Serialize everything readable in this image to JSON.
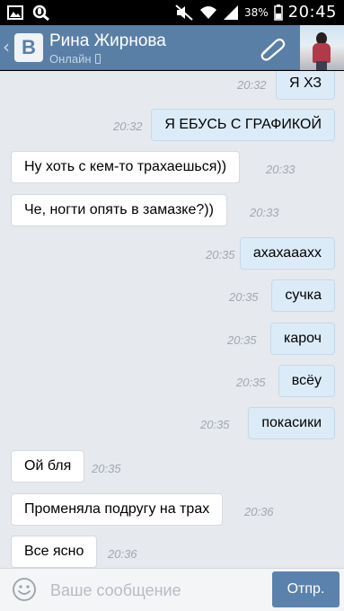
{
  "status_bar": {
    "battery_percent": "38%",
    "time": "20:45",
    "icons": [
      "image-icon",
      "voice-search-icon",
      "mute-icon",
      "wifi-icon",
      "signal-icon",
      "battery-icon"
    ]
  },
  "header": {
    "logo_text": "B",
    "contact_name": "Рина Жирнова",
    "contact_status": "Онлайн",
    "icons": [
      "back-arrow-icon",
      "vk-logo",
      "phone-icon",
      "paperclip-icon",
      "avatar"
    ],
    "colors": {
      "header_bg": "#5a7fa6",
      "outgoing_bubble": "#dcebf8",
      "incoming_bubble": "#ffffff",
      "chat_bg": "#e6e9ee",
      "send_button": "#5b82ad"
    }
  },
  "messages": [
    {
      "direction": "out",
      "text": "Я ХЗ",
      "time": "20:32"
    },
    {
      "direction": "out",
      "text": "Я ЕБУСЬ С ГРАФИКОЙ",
      "time": "20:32"
    },
    {
      "direction": "in",
      "text": "Ну хоть с кем-то трахаешься))",
      "time": "20:33"
    },
    {
      "direction": "in",
      "text": "Че, ногти опять в замазке?))",
      "time": "20:33"
    },
    {
      "direction": "out",
      "text": "ахахааахх",
      "time": "20:35"
    },
    {
      "direction": "out",
      "text": "сучка",
      "time": "20:35"
    },
    {
      "direction": "out",
      "text": "кароч",
      "time": "20:35"
    },
    {
      "direction": "out",
      "text": "всёу",
      "time": "20:35"
    },
    {
      "direction": "out",
      "text": "покасики",
      "time": "20:35"
    },
    {
      "direction": "in",
      "text": "Ой бля",
      "time": "20:35"
    },
    {
      "direction": "in",
      "text": "Променяла подругу на трах",
      "time": "20:36"
    },
    {
      "direction": "in",
      "text": "Все ясно",
      "time": "20:36"
    }
  ],
  "input": {
    "placeholder": "Ваше сообщение",
    "value": "",
    "send_label": "Отпр.",
    "icons": [
      "smiley-icon"
    ]
  }
}
